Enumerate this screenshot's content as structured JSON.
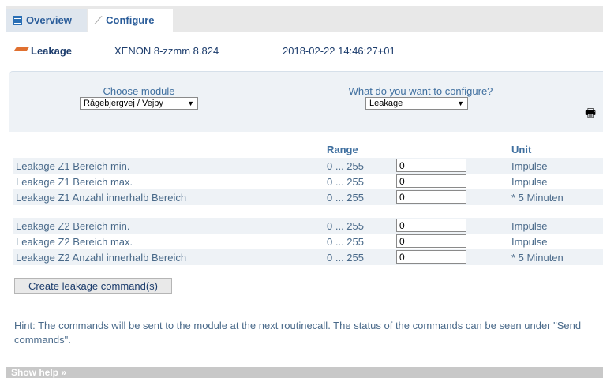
{
  "tabs": [
    {
      "label": "Overview",
      "icon": "overview-icon"
    },
    {
      "label": "Configure",
      "icon": "wrench-icon"
    }
  ],
  "info": {
    "label": "Leakage",
    "device": "XENON 8-zzmm 8.824",
    "timestamp": "2018-02-22 14:46:27+01"
  },
  "selectors": {
    "module_label": "Choose module",
    "module_value": "Rågebjergvej / Vejby",
    "configure_label": "What do you want to configure?",
    "configure_value": "Leakage"
  },
  "table": {
    "header_range": "Range",
    "header_unit": "Unit",
    "rows": [
      {
        "label": "Leakage Z1 Bereich min.",
        "range": "0 ... 255",
        "value": "0",
        "unit": "Impulse"
      },
      {
        "label": "Leakage Z1 Bereich max.",
        "range": "0 ... 255",
        "value": "0",
        "unit": "Impulse"
      },
      {
        "label": "Leakage Z1 Anzahl innerhalb Bereich",
        "range": "0 ... 255",
        "value": "0",
        "unit": "* 5 Minuten"
      },
      {
        "label": "Leakage Z2 Bereich min.",
        "range": "0 ... 255",
        "value": "0",
        "unit": "Impulse"
      },
      {
        "label": "Leakage Z2 Bereich max.",
        "range": "0 ... 255",
        "value": "0",
        "unit": "Impulse"
      },
      {
        "label": "Leakage Z2 Anzahl innerhalb Bereich",
        "range": "0 ... 255",
        "value": "0",
        "unit": "* 5 Minuten"
      }
    ]
  },
  "create_button_label": "Create leakage command(s)",
  "hint": "Hint: The commands will be sent to the module at the next routinecall. The status of the commands can be seen under \"Send commands\".",
  "show_help_label": "Show help »",
  "colors": {
    "link": "#2b5d9a",
    "text": "#4a6a8a",
    "panel": "#eef2f6",
    "accent": "#e07030"
  }
}
